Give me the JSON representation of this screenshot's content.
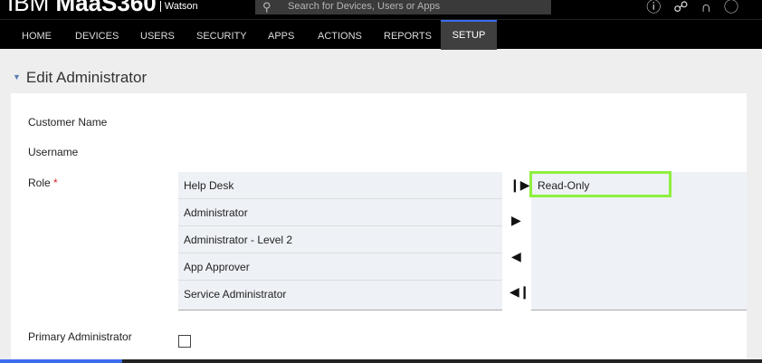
{
  "header": {
    "brand": "IBM",
    "product": "MaaS360",
    "sub": "Watson",
    "search_placeholder": "Search for Devices, Users or Apps"
  },
  "nav": {
    "items": [
      "HOME",
      "DEVICES",
      "USERS",
      "SECURITY",
      "APPS",
      "ACTIONS",
      "REPORTS",
      "SETUP"
    ],
    "active": "SETUP",
    "accent": "#3c6df0"
  },
  "page": {
    "title": "Edit Administrator"
  },
  "form": {
    "customer_name_label": "Customer Name",
    "username_label": "Username",
    "role_label": "Role",
    "required_mark": "*",
    "primary_admin_label": "Primary Administrator",
    "primary_admin_checked": false
  },
  "roles": {
    "available": [
      "Help Desk",
      "Administrator",
      "Administrator - Level 2",
      "App Approver",
      "Service Administrator"
    ],
    "selected": [
      "Read-Only"
    ],
    "highlight_color": "#8ef03e"
  }
}
